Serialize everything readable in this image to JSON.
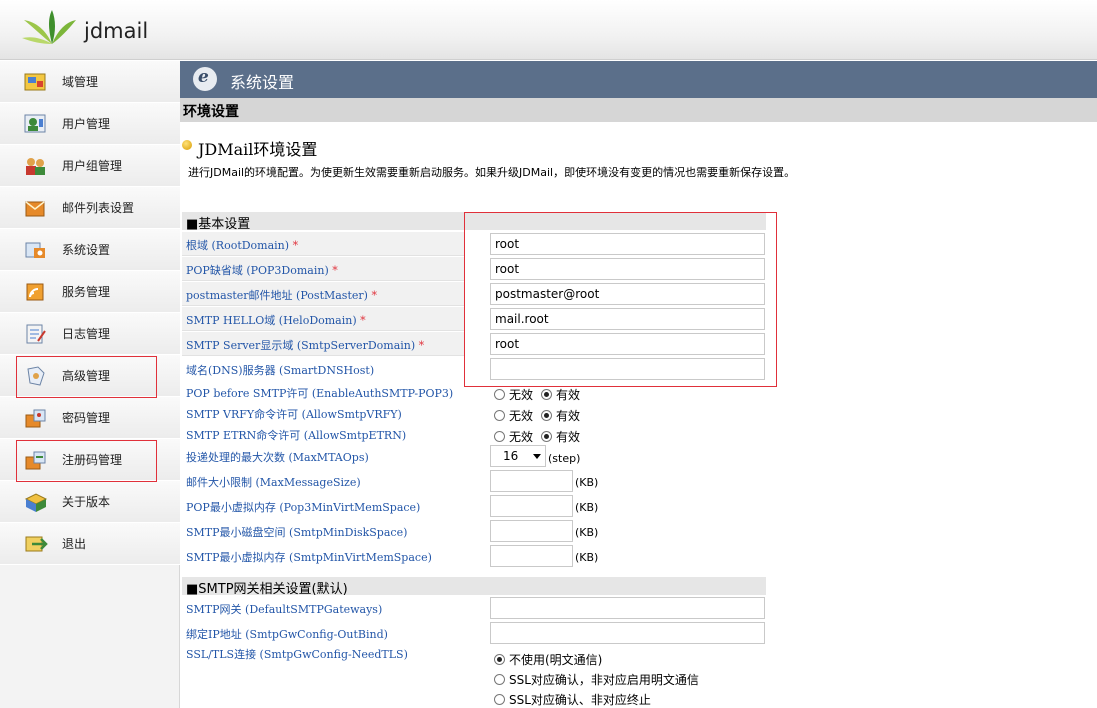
{
  "app": {
    "brand": "jdmail"
  },
  "sidebar": {
    "items": [
      {
        "label": "域管理",
        "icon": "domain-icon"
      },
      {
        "label": "用户管理",
        "icon": "user-icon"
      },
      {
        "label": "用户组管理",
        "icon": "group-icon"
      },
      {
        "label": "邮件列表设置",
        "icon": "mailing-list-icon"
      },
      {
        "label": "系统设置",
        "icon": "system-icon"
      },
      {
        "label": "服务管理",
        "icon": "service-icon"
      },
      {
        "label": "日志管理",
        "icon": "log-icon"
      },
      {
        "label": "高级管理",
        "icon": "advanced-icon"
      },
      {
        "label": "密码管理",
        "icon": "password-icon"
      },
      {
        "label": "注册码管理",
        "icon": "license-icon"
      },
      {
        "label": "关于版本",
        "icon": "about-icon"
      },
      {
        "label": "退出",
        "icon": "logout-icon"
      }
    ]
  },
  "main": {
    "title": "系统设置",
    "subtitle": "环境设置",
    "section_title": "JDMail环境设置",
    "intro": "进行JDMail的环境配置。为使更新生效需要重新启动服务。如果升级JDMail，即使环境没有变更的情况也需要重新保存设置。",
    "basic": {
      "heading": "■基本设置",
      "fields": [
        {
          "label": "根域  (RootDomain)",
          "required": "*",
          "value": "root"
        },
        {
          "label": "POP缺省域  (POP3Domain)",
          "required": "*",
          "value": "root"
        },
        {
          "label": "postmaster邮件地址  (PostMaster)",
          "required": "*",
          "value": "postmaster@root"
        },
        {
          "label": "SMTP HELLO域  (HeloDomain)",
          "required": "*",
          "value": "mail.root"
        },
        {
          "label": "SMTP Server显示域  (SmtpServerDomain)",
          "required": "*",
          "value": "root"
        },
        {
          "label": "域名(DNS)服务器  (SmartDNSHost)",
          "required": "",
          "value": ""
        }
      ],
      "radios": [
        {
          "label": "POP before SMTP许可  (EnableAuthSMTP-POP3)",
          "off": "无效",
          "on": "有效"
        },
        {
          "label": "SMTP VRFY命令许可  (AllowSmtpVRFY)",
          "off": "无效",
          "on": "有效"
        },
        {
          "label": "SMTP ETRN命令许可  (AllowSmtpETRN)",
          "off": "无效",
          "on": "有效"
        }
      ],
      "max_mta": {
        "label": "投递处理的最大次数  (MaxMTAOps)",
        "value": "16",
        "unit": "(step)"
      },
      "size_fields": [
        {
          "label": "邮件大小限制  (MaxMessageSize)",
          "unit": "(KB)"
        },
        {
          "label": "POP最小虚拟内存  (Pop3MinVirtMemSpace)",
          "unit": "(KB)"
        },
        {
          "label": "SMTP最小磁盘空间  (SmtpMinDiskSpace)",
          "unit": "(KB)"
        },
        {
          "label": "SMTP最小虚拟内存  (SmtpMinVirtMemSpace)",
          "unit": "(KB)"
        }
      ]
    },
    "gateway": {
      "heading": "■SMTP网关相关设置(默认)",
      "fields": [
        {
          "label": "SMTP网关  (DefaultSMTPGateways)"
        },
        {
          "label": "绑定IP地址  (SmtpGwConfig-OutBind)"
        }
      ],
      "tls": {
        "label": "SSL/TLS连接  (SmtpGwConfig-NeedTLS)",
        "options": [
          "不使用(明文通信)",
          "SSL对应确认，非对应启用明文通信",
          "SSL对应确认、非对应终止"
        ]
      }
    }
  }
}
